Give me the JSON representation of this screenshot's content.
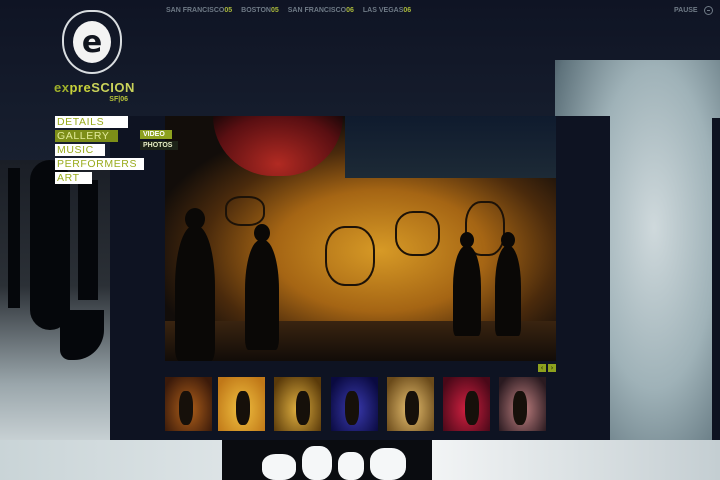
{
  "logo": {
    "mark": "e",
    "word_part1": "ex",
    "word_part2": "pre",
    "word_part3": "SCION",
    "sub": "SF|06"
  },
  "city_nav": [
    {
      "city": "SAN FRANCISCO",
      "year": "05"
    },
    {
      "city": "BOSTON",
      "year": "05"
    },
    {
      "city": "SAN FRANCISCO",
      "year": "06"
    },
    {
      "city": "LAS VEGAS",
      "year": "06"
    }
  ],
  "pause": {
    "label": "PAUSE"
  },
  "menu": [
    {
      "label": "DETAILS",
      "state": "normal"
    },
    {
      "label": "GALLERY",
      "state": "active"
    },
    {
      "label": "MUSIC",
      "state": "normal"
    },
    {
      "label": "PERFORMERS",
      "state": "normal"
    },
    {
      "label": "ART",
      "state": "normal"
    }
  ],
  "submenu": [
    {
      "label": "VIDEO",
      "state": "active"
    },
    {
      "label": "PHOTOS",
      "state": "normal"
    }
  ],
  "photo_nav": {
    "prev": "‹",
    "next": "›"
  },
  "thumbnails": [
    {
      "name": "thumb-breakdancer",
      "colors": [
        "#3b1a0a",
        "#b0601a"
      ]
    },
    {
      "name": "thumb-dancer-stage",
      "colors": [
        "#c07818",
        "#f0c040"
      ]
    },
    {
      "name": "thumb-graffiti-wall",
      "colors": [
        "#5a3a0a",
        "#e0b040"
      ]
    },
    {
      "name": "thumb-blue-performer",
      "colors": [
        "#0a0a40",
        "#3a3ab0"
      ]
    },
    {
      "name": "thumb-dancer-spin",
      "colors": [
        "#6a4a1a",
        "#e8c070"
      ]
    },
    {
      "name": "thumb-red-crowd",
      "colors": [
        "#4a0818",
        "#d02040"
      ]
    },
    {
      "name": "thumb-two-dancers",
      "colors": [
        "#2a1a20",
        "#c08080"
      ]
    }
  ],
  "colors": {
    "accent": "#8da11e",
    "panel": "#0e1322"
  }
}
